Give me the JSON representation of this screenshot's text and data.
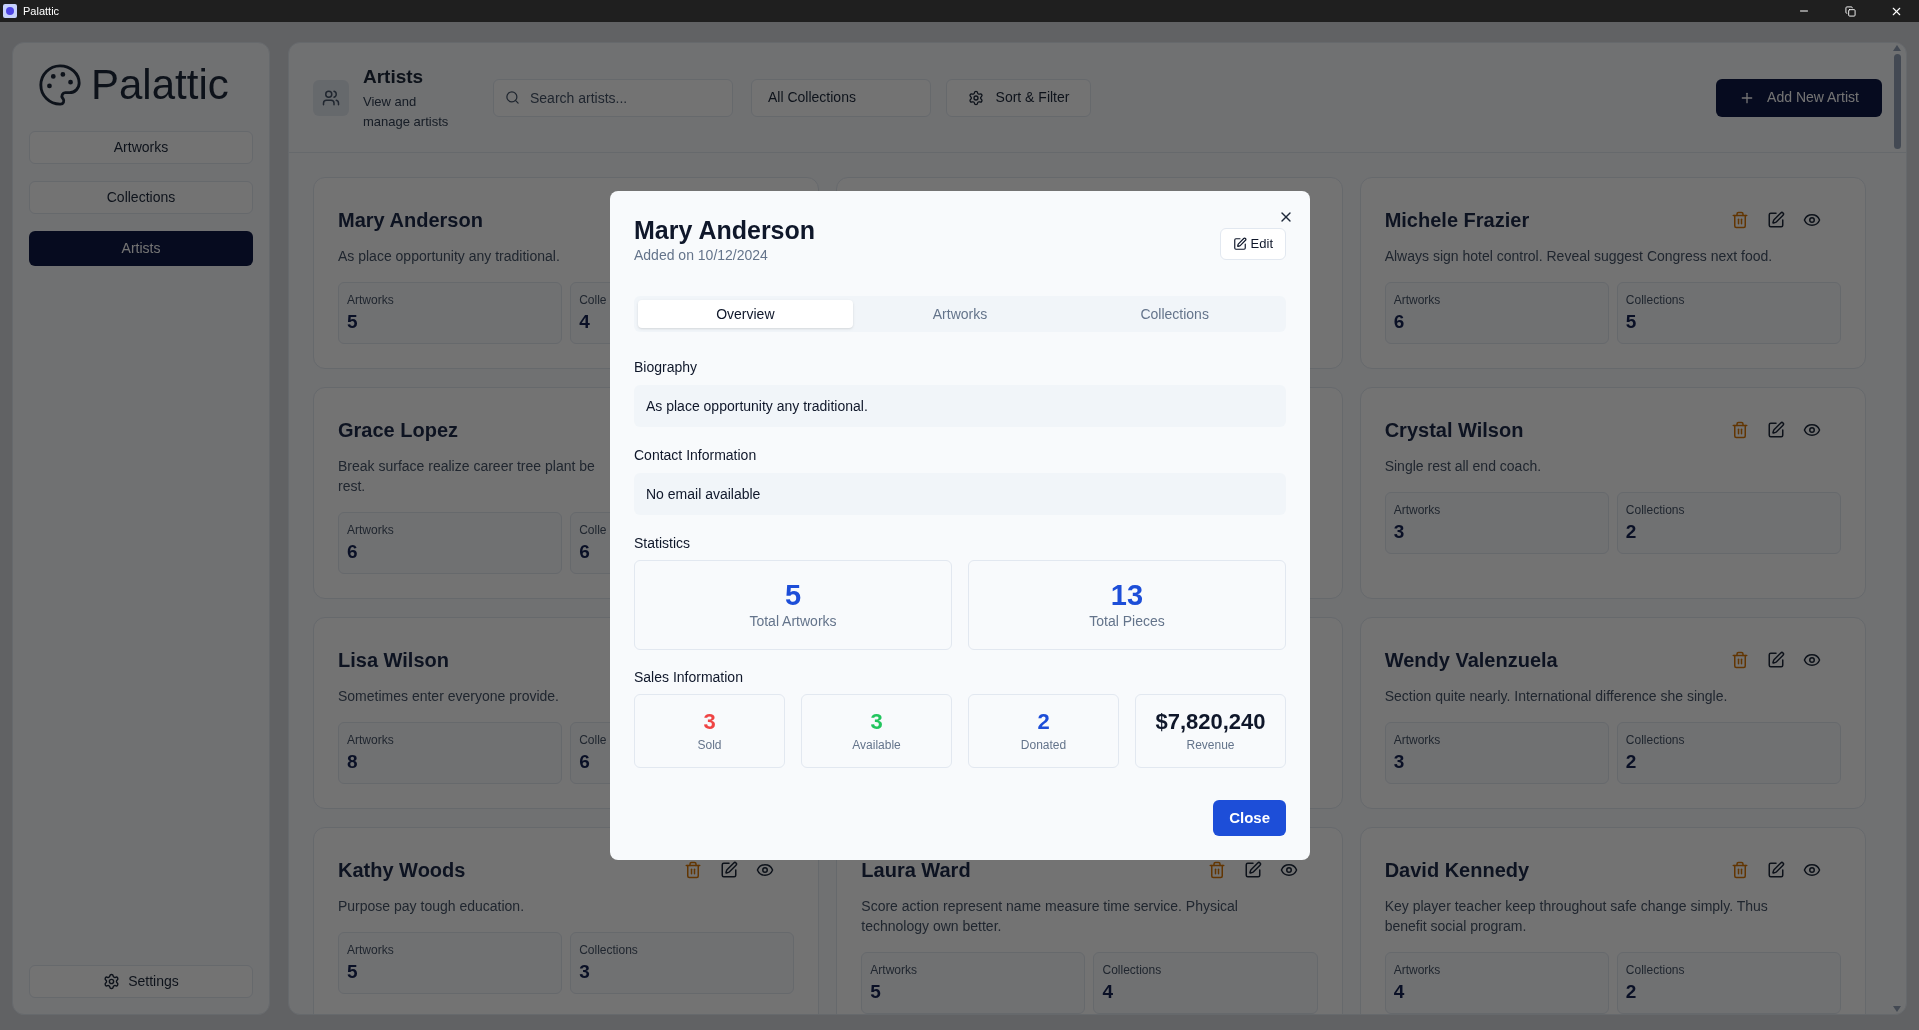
{
  "window": {
    "title": "Palattic"
  },
  "sidebar": {
    "logo": "Palattic",
    "nav": [
      {
        "label": "Artworks",
        "selected": false
      },
      {
        "label": "Collections",
        "selected": false
      },
      {
        "label": "Artists",
        "selected": true
      }
    ],
    "settings": "Settings"
  },
  "header": {
    "title": "Artists",
    "subtitle": "View and manage artists",
    "search": {
      "placeholder": "Search artists..."
    },
    "collection_filter": "All Collections",
    "sort_button": "Sort & Filter",
    "add_button": "Add New Artist"
  },
  "cards": [
    {
      "kind": "artist",
      "name": "Mary Anderson",
      "description_lines": [
        "As place opportunity any traditional."
      ],
      "stats": [
        {
          "label": "Artworks",
          "value": "5"
        },
        {
          "label": "Colle",
          "value": "4"
        }
      ]
    },
    {
      "kind": "covered"
    },
    {
      "kind": "artist",
      "name": "Michele Frazier",
      "description_lines": [
        "Always sign hotel control. Reveal suggest Congress next food."
      ],
      "actions": [
        {
          "kind": "delete"
        },
        {
          "kind": "edit"
        },
        {
          "kind": "view"
        }
      ],
      "stats": [
        {
          "label": "Artworks",
          "value": "6"
        },
        {
          "label": "Collections",
          "value": "5"
        }
      ]
    },
    {
      "kind": "artist",
      "name": "Grace Lopez",
      "description_lines": [
        "Break surface realize career tree plant be",
        "rest."
      ],
      "stats": [
        {
          "label": "Artworks",
          "value": "6"
        },
        {
          "label": "Colle",
          "value": "6"
        }
      ]
    },
    {
      "kind": "covered"
    },
    {
      "kind": "artist",
      "name": "Crystal Wilson",
      "description_lines": [
        "Single rest all end coach."
      ],
      "actions": [
        {
          "kind": "delete"
        },
        {
          "kind": "edit"
        },
        {
          "kind": "view"
        }
      ],
      "stats": [
        {
          "label": "Artworks",
          "value": "3"
        },
        {
          "label": "Collections",
          "value": "2"
        }
      ]
    },
    {
      "kind": "artist",
      "name": "Lisa Wilson",
      "description_lines": [
        "Sometimes enter everyone provide."
      ],
      "stats": [
        {
          "label": "Artworks",
          "value": "8"
        },
        {
          "label": "Colle",
          "value": "6"
        }
      ]
    },
    {
      "kind": "covered"
    },
    {
      "kind": "artist",
      "name": "Wendy Valenzuela",
      "description_lines": [
        "Section quite nearly. International difference she single."
      ],
      "actions": [
        {
          "kind": "delete"
        },
        {
          "kind": "edit"
        },
        {
          "kind": "view"
        }
      ],
      "stats": [
        {
          "label": "Artworks",
          "value": "3"
        },
        {
          "label": "Collections",
          "value": "2"
        }
      ]
    },
    {
      "kind": "artist",
      "name": "Kathy Woods",
      "description_lines": [
        "Purpose pay tough education."
      ],
      "actions": [
        {
          "kind": "delete"
        },
        {
          "kind": "edit"
        },
        {
          "kind": "view"
        }
      ],
      "stats": [
        {
          "label": "Artworks",
          "value": "5"
        },
        {
          "label": "Collections",
          "value": "3"
        }
      ]
    },
    {
      "kind": "artist",
      "name": "Laura Ward",
      "description_lines": [
        "Score action represent name measure time service. Physical",
        "technology own better."
      ],
      "actions": [
        {
          "kind": "delete"
        },
        {
          "kind": "edit"
        },
        {
          "kind": "view"
        }
      ],
      "stats": [
        {
          "label": "Artworks",
          "value": "5"
        },
        {
          "label": "Collections",
          "value": "4"
        }
      ]
    },
    {
      "kind": "artist",
      "name": "David Kennedy",
      "description_lines": [
        "Key player teacher keep throughout safe change simply. Thus",
        "benefit social program."
      ],
      "actions": [
        {
          "kind": "delete"
        },
        {
          "kind": "edit"
        },
        {
          "kind": "view"
        }
      ],
      "stats": [
        {
          "label": "Artworks",
          "value": "4"
        },
        {
          "label": "Collections",
          "value": "2"
        }
      ]
    }
  ],
  "modal": {
    "title": "Mary Anderson",
    "subtitle": "Added on 10/12/2024",
    "edit_button": "Edit",
    "tabs": [
      {
        "label": "Overview",
        "selected": true
      },
      {
        "label": "Artworks",
        "selected": false
      },
      {
        "label": "Collections",
        "selected": false
      }
    ],
    "biography": {
      "label": "Biography",
      "text": "As place opportunity any traditional."
    },
    "contact": {
      "label": "Contact Information",
      "text": "No email available"
    },
    "statistics": {
      "label": "Statistics",
      "items": [
        {
          "value": "5",
          "label": "Total Artworks"
        },
        {
          "value": "13",
          "label": "Total Pieces"
        }
      ]
    },
    "sales": {
      "label": "Sales Information",
      "items": [
        {
          "value": "3",
          "label": "Sold",
          "color": "#ef4444"
        },
        {
          "value": "3",
          "label": "Available",
          "color": "#22c55e"
        },
        {
          "value": "2",
          "label": "Donated",
          "color": "#1d4ed8"
        },
        {
          "value": "$7,820,240",
          "label": "Revenue",
          "color": "#0f172a"
        }
      ]
    },
    "close_button": "Close"
  }
}
